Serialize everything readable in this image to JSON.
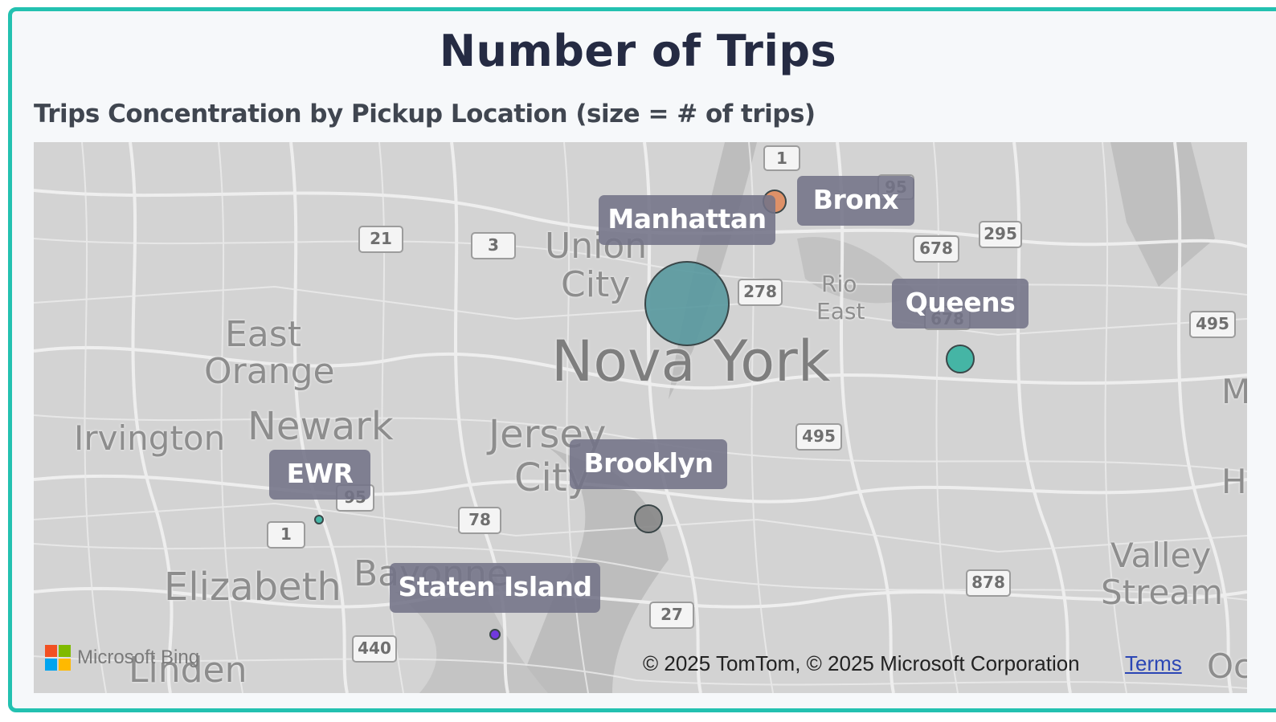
{
  "title": "Number of Trips",
  "subtitle": "Trips Concentration by Pickup Location (size = # of trips)",
  "map": {
    "places": [
      {
        "name": "Union",
        "size": "large"
      },
      {
        "name": "City",
        "size": "large"
      },
      {
        "name": "East",
        "size": "large"
      },
      {
        "name": "Orange",
        "size": "large"
      },
      {
        "name": "Nova York",
        "size": "xlarge"
      },
      {
        "name": "Rio",
        "size": "small"
      },
      {
        "name": "East",
        "size": "small"
      },
      {
        "name": "Irvington",
        "size": "large"
      },
      {
        "name": "Newark",
        "size": "large"
      },
      {
        "name": "Jersey",
        "size": "large"
      },
      {
        "name": "City",
        "size": "large"
      },
      {
        "name": "Elizabeth",
        "size": "large"
      },
      {
        "name": "Bayonne",
        "size": "large"
      },
      {
        "name": "Linden",
        "size": "large"
      },
      {
        "name": "Valley",
        "size": "large"
      },
      {
        "name": "Stream",
        "size": "large"
      },
      {
        "name": "M",
        "size": "large"
      },
      {
        "name": "H",
        "size": "large"
      },
      {
        "name": "Oc",
        "size": "large"
      }
    ],
    "shields": [
      "1",
      "95",
      "21",
      "3",
      "678",
      "295",
      "278",
      "678",
      "495",
      "495",
      "95",
      "1",
      "78",
      "878",
      "27",
      "440"
    ],
    "boroughs": [
      {
        "name": "Manhattan",
        "color": "#5b9aa0",
        "relative_trips": 1.0
      },
      {
        "name": "Bronx",
        "color": "#e08c5f",
        "relative_trips": 0.08
      },
      {
        "name": "Queens",
        "color": "#3ab3a2",
        "relative_trips": 0.12
      },
      {
        "name": "Brooklyn",
        "color": "#8a8a8a",
        "relative_trips": 0.12
      },
      {
        "name": "EWR",
        "color": "#3ab3a2",
        "relative_trips": 0.01
      },
      {
        "name": "Staten Island",
        "color": "#6a2de0",
        "relative_trips": 0.02
      }
    ],
    "provider": "Microsoft Bing",
    "copyright": "© 2025 TomTom, © 2025 Microsoft Corporation",
    "terms": "Terms"
  }
}
